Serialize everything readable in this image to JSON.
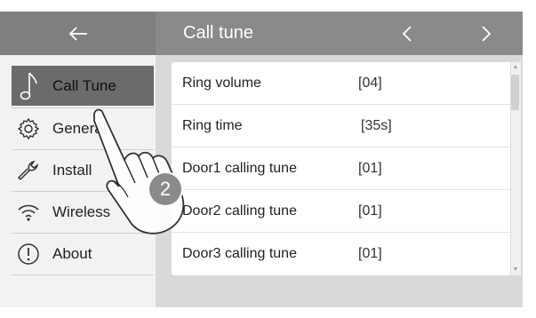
{
  "header": {
    "back_icon": "arrow-left-icon",
    "title": "Call tune",
    "prev_icon": "chevron-left-icon",
    "next_icon": "chevron-right-icon"
  },
  "sidebar": {
    "items": [
      {
        "label": "Call Tune",
        "icon": "music-note-icon",
        "active": true
      },
      {
        "label": "General",
        "icon": "gear-icon",
        "active": false
      },
      {
        "label": "Install",
        "icon": "wrench-icon",
        "active": false
      },
      {
        "label": "Wireless",
        "icon": "wifi-icon",
        "active": false
      },
      {
        "label": "About",
        "icon": "info-icon",
        "active": false
      }
    ]
  },
  "settings": {
    "rows": [
      {
        "name": "Ring volume",
        "value": "[04]"
      },
      {
        "name": "Ring time",
        "value": "[35s]"
      },
      {
        "name": "Door1 calling tune",
        "value": "[01]"
      },
      {
        "name": "Door2 calling tune",
        "value": "[01]"
      },
      {
        "name": "Door3 calling tune",
        "value": "[01]"
      }
    ]
  },
  "annotation": {
    "step_number": "2"
  },
  "colors": {
    "header_left": "#7f7f7f",
    "header_right": "#8a8a8a",
    "sidebar_bg": "#f2f2f2",
    "active_item": "#6b6b6b",
    "main_bg": "#d9d9d9"
  }
}
